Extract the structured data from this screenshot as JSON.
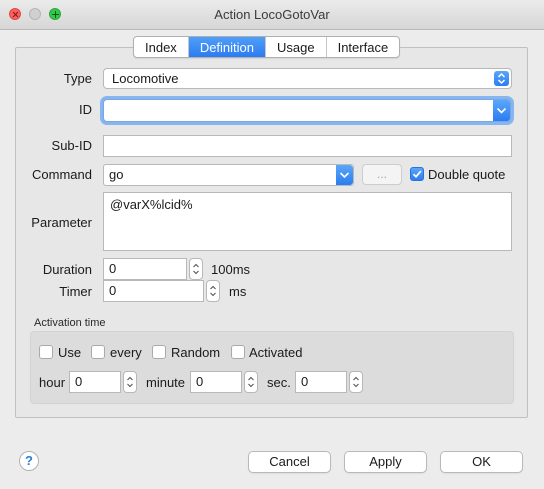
{
  "window": {
    "title": "Action LocoGotoVar"
  },
  "tabs": [
    {
      "label": "Index",
      "active": false
    },
    {
      "label": "Definition",
      "active": true
    },
    {
      "label": "Usage",
      "active": false
    },
    {
      "label": "Interface",
      "active": false
    }
  ],
  "form": {
    "type": {
      "label": "Type",
      "value": "Locomotive"
    },
    "id": {
      "label": "ID",
      "value": ""
    },
    "subid": {
      "label": "Sub-ID",
      "value": ""
    },
    "command": {
      "label": "Command",
      "value": "go",
      "dots_label": "...",
      "double_quote_label": "Double quote",
      "double_quote_checked": true
    },
    "parameter": {
      "label": "Parameter",
      "value": "@varX%lcid%"
    },
    "duration": {
      "label": "Duration",
      "value": "0",
      "unit": "100ms"
    },
    "timer": {
      "label": "Timer",
      "value": "0",
      "unit": "ms"
    }
  },
  "activation": {
    "title": "Activation time",
    "checkboxes": [
      {
        "label": "Use",
        "checked": false
      },
      {
        "label": "every",
        "checked": false
      },
      {
        "label": "Random",
        "checked": false
      },
      {
        "label": "Activated",
        "checked": false
      }
    ],
    "hour": {
      "label": "hour",
      "value": "0"
    },
    "minute": {
      "label": "minute",
      "value": "0"
    },
    "sec": {
      "label": "sec.",
      "value": "0"
    }
  },
  "footer": {
    "help": "?",
    "cancel": "Cancel",
    "apply": "Apply",
    "ok": "OK"
  },
  "colors": {
    "accent": "#2b7cf2",
    "focus_ring": "#86b5ef"
  }
}
